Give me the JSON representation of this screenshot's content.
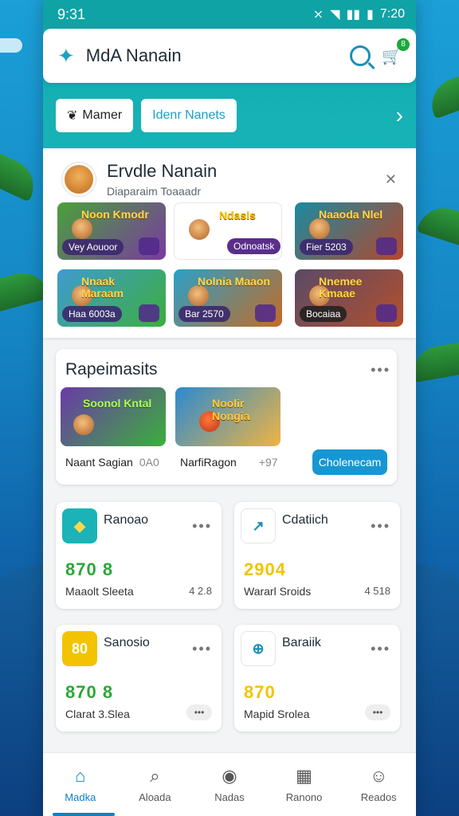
{
  "status": {
    "time": "9:31",
    "right_time": "7:20"
  },
  "header": {
    "title": "MdA Nanain",
    "badge_count": "8"
  },
  "chips": {
    "left": "Mamer",
    "right": "Idenr Nanets"
  },
  "featured": {
    "title": "Ervdle Nanain",
    "subtitle": "Diaparaim Toaaadr",
    "tiles": [
      {
        "title": "Noon Kmodr",
        "pill": "Vey Aouoor"
      },
      {
        "title": "Ndasls",
        "pill": "Odnoatsk"
      },
      {
        "title": "Naaoda Nlel",
        "pill": "Fier 5203"
      },
      {
        "title": "Nnaak Maraam",
        "pill": "Haa 6003a"
      },
      {
        "title": "Nolnia Maaon",
        "pill": "Bar 2570"
      },
      {
        "title": "Nnemee Kmaae",
        "pill": "Bocaiaa"
      }
    ]
  },
  "premium": {
    "title": "Rapeimasits",
    "items": [
      {
        "title": "Soonol Kntal",
        "label": "Naant Sagian",
        "meta": "0A0"
      },
      {
        "title": "Noolir Nongia",
        "label": "NarfiRagon",
        "meta": "+97"
      }
    ],
    "button": "Cholenecam"
  },
  "stats": [
    {
      "title": "Ranoao",
      "number": "870 8",
      "footer": "Maaolt Sleeta",
      "value": "4 2.8"
    },
    {
      "title": "Cdatiich",
      "number": "2904",
      "footer": "Wararl Sroids",
      "value": "4 518"
    },
    {
      "title": "Sanosio",
      "icon_text": "80",
      "number": "870 8",
      "footer": "Clarat 3.Slea"
    },
    {
      "title": "Baraiik",
      "number": "870",
      "footer": "Mapid Srolea"
    }
  ],
  "nav": [
    {
      "label": "Madka",
      "icon": "home-icon"
    },
    {
      "label": "Aloada",
      "icon": "search-icon"
    },
    {
      "label": "Nadas",
      "icon": "camera-icon"
    },
    {
      "label": "Ranono",
      "icon": "calendar-icon"
    },
    {
      "label": "Reados",
      "icon": "profile-icon"
    }
  ]
}
